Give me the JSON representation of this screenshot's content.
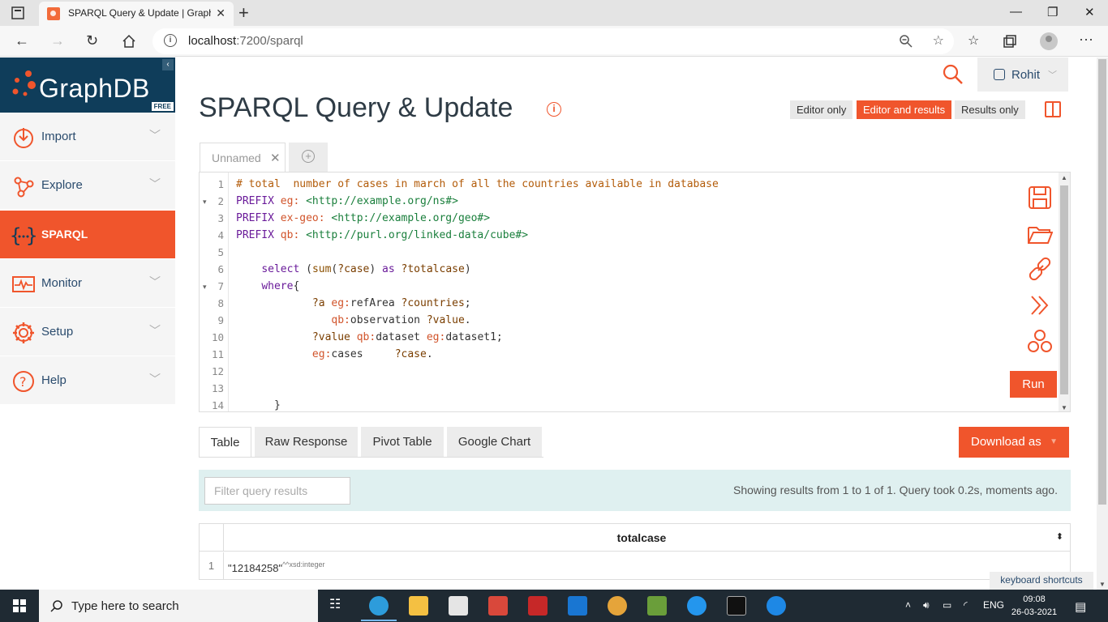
{
  "browser": {
    "tab_title": "SPARQL Query & Update | GraphDB Workbench",
    "url_host": "localhost",
    "url_rest": ":7200/sparql",
    "new_tab": "+",
    "close_tab": "✕"
  },
  "app": {
    "logo": "GraphDB",
    "edition": "FREE",
    "collapse": "‹"
  },
  "sidebar": {
    "items": [
      {
        "label": "Import"
      },
      {
        "label": "Explore"
      },
      {
        "label": "SPARQL"
      },
      {
        "label": "Monitor"
      },
      {
        "label": "Setup"
      },
      {
        "label": "Help"
      }
    ]
  },
  "header": {
    "user": "Rohit",
    "title": "SPARQL Query & Update",
    "info": "i"
  },
  "view_modes": {
    "editor_only": "Editor only",
    "editor_and_results": "Editor and results",
    "results_only": "Results only"
  },
  "query_tab": {
    "name": "Unnamed",
    "close": "✕",
    "add": "+"
  },
  "editor": {
    "run_label": "Run",
    "lines": [
      {
        "n": "1",
        "fold": false,
        "code": "# total  number of cases in march of all the countries available in database"
      },
      {
        "n": "2",
        "fold": true,
        "code": "PREFIX eg: <http://example.org/ns#>"
      },
      {
        "n": "3",
        "fold": false,
        "code": "PREFIX ex-geo: <http://example.org/geo#>"
      },
      {
        "n": "4",
        "fold": false,
        "code": "PREFIX qb: <http://purl.org/linked-data/cube#>"
      },
      {
        "n": "5",
        "fold": false,
        "code": ""
      },
      {
        "n": "6",
        "fold": false,
        "code": "    select (sum(?case) as ?totalcase)"
      },
      {
        "n": "7",
        "fold": true,
        "code": "    where{"
      },
      {
        "n": "8",
        "fold": false,
        "code": "            ?a eg:refArea ?countries;"
      },
      {
        "n": "9",
        "fold": false,
        "code": "               qb:observation ?value."
      },
      {
        "n": "10",
        "fold": false,
        "code": "            ?value qb:dataset eg:dataset1;"
      },
      {
        "n": "11",
        "fold": false,
        "code": "            eg:cases     ?case."
      },
      {
        "n": "12",
        "fold": false,
        "code": ""
      },
      {
        "n": "13",
        "fold": false,
        "code": ""
      },
      {
        "n": "14",
        "fold": false,
        "code": "      }"
      }
    ]
  },
  "results_tabs": {
    "table": "Table",
    "raw": "Raw Response",
    "pivot": "Pivot Table",
    "chart": "Google Chart"
  },
  "download_label": "Download as",
  "filter": {
    "placeholder": "Filter query results",
    "status": "Showing results from 1 to 1 of 1. Query took 0.2s, moments ago."
  },
  "results_table": {
    "column": "totalcase",
    "rows": [
      {
        "n": "1",
        "value": "\"12184258\"",
        "datatype": "^^xsd:integer"
      }
    ]
  },
  "keyboard_shortcuts": "keyboard shortcuts",
  "taskbar": {
    "search_placeholder": "Type here to search",
    "lang": "ENG",
    "time": "09:08",
    "date": "26-03-2021"
  },
  "colors": {
    "accent": "#f0552c",
    "navy": "#0f3d5a",
    "text_blue": "#2a4b6d"
  }
}
